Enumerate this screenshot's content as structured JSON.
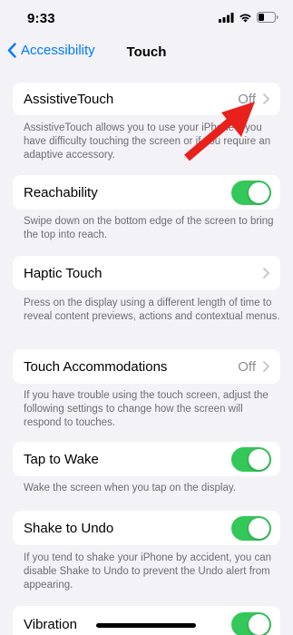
{
  "status_bar": {
    "time": "9:33"
  },
  "nav": {
    "back_label": "Accessibility",
    "title": "Touch"
  },
  "settings": [
    {
      "label": "AssistiveTouch",
      "value": "Off",
      "control": "disclosure",
      "footer": "AssistiveTouch allows you to use your iPhone if you have difficulty touching the screen or if you require an adaptive accessory."
    },
    {
      "label": "Reachability",
      "control": "toggle",
      "on": true,
      "footer": "Swipe down on the bottom edge of the screen to bring the top into reach."
    },
    {
      "label": "Haptic Touch",
      "value": "",
      "control": "disclosure",
      "footer": "Press on the display using a different length of time to reveal content previews, actions and contextual menus."
    },
    {
      "label": "Touch Accommodations",
      "value": "Off",
      "control": "disclosure",
      "footer": "If you have trouble using the touch screen, adjust the following settings to change how the screen will respond to touches."
    },
    {
      "label": "Tap to Wake",
      "control": "toggle",
      "on": true,
      "footer": "Wake the screen when you tap on the display."
    },
    {
      "label": "Shake to Undo",
      "control": "toggle",
      "on": true,
      "footer": "If you tend to shake your iPhone by accident, you can disable Shake to Undo to prevent the Undo alert from appearing."
    },
    {
      "label": "Vibration",
      "control": "toggle",
      "on": true
    }
  ],
  "colors": {
    "accent": "#007aff",
    "toggle_on": "#34c759",
    "annotation_arrow": "#e8211c"
  },
  "icons": [
    "cellular-signal-icon",
    "wifi-icon",
    "battery-icon",
    "chevron-left-icon",
    "chevron-right-icon",
    "red-arrow-annotation"
  ]
}
